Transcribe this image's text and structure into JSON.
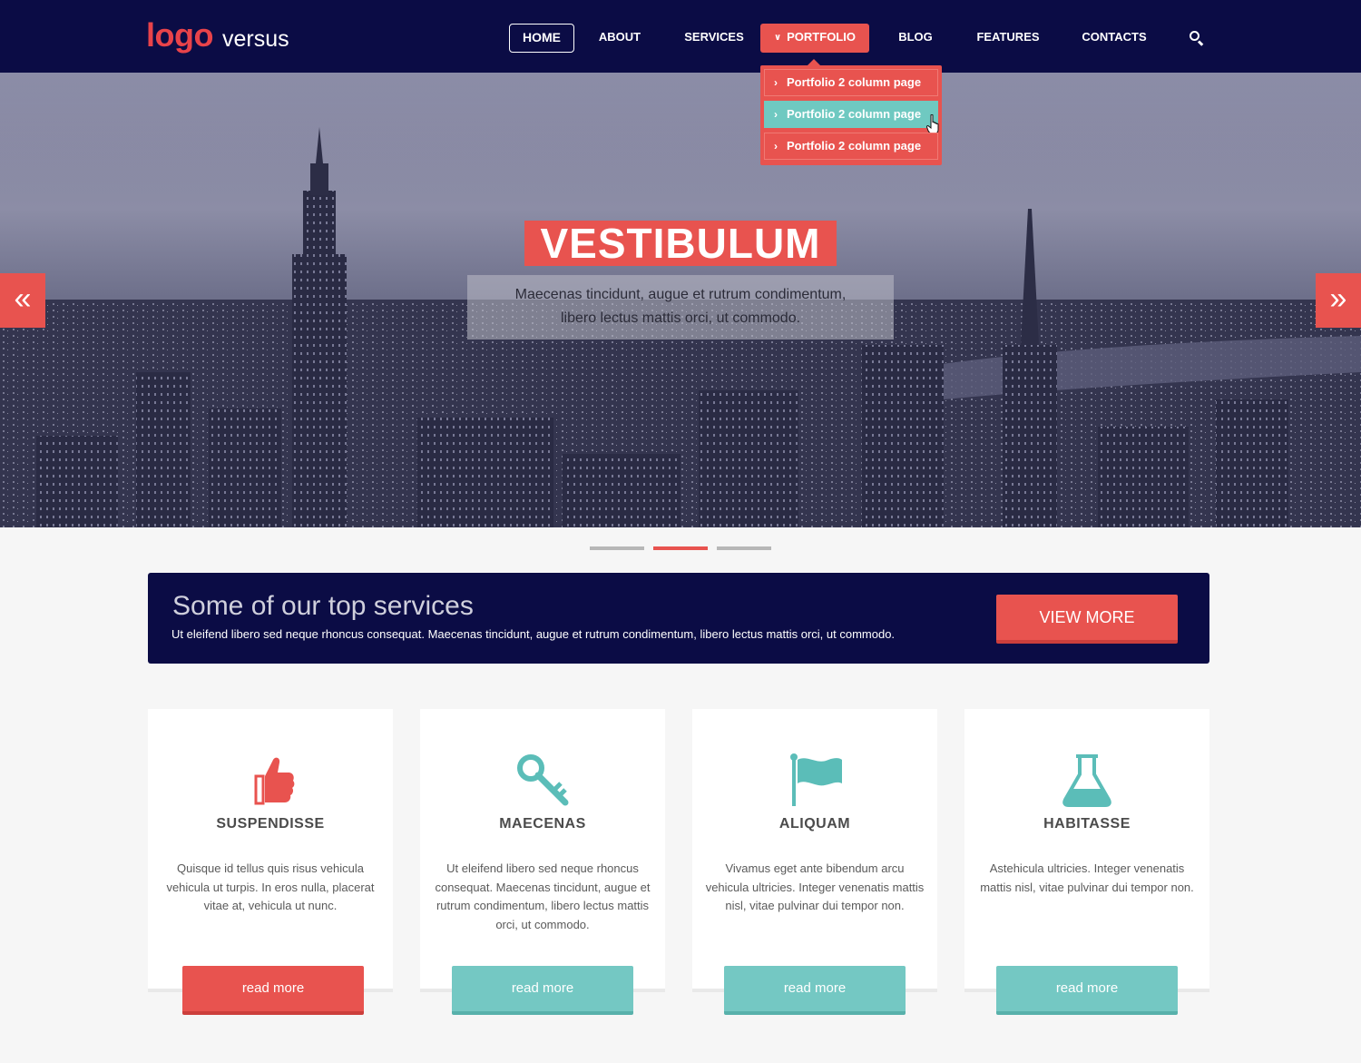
{
  "brand": {
    "logo_mark": "logo",
    "logo_text": "versus"
  },
  "nav": {
    "items": [
      {
        "label": "HOME"
      },
      {
        "label": "ABOUT"
      },
      {
        "label": "SERVICES"
      },
      {
        "label": "PORTFOLIO",
        "icon": "chevron-down-icon"
      },
      {
        "label": "BLOG"
      },
      {
        "label": "FEATURES"
      },
      {
        "label": "CONTACTS"
      }
    ],
    "search_icon": "search-icon",
    "dropdown": [
      {
        "label": "Portfolio 2 column page"
      },
      {
        "label": "Portfolio 2 column page"
      },
      {
        "label": "Portfolio 2 column page"
      }
    ]
  },
  "hero": {
    "title": "VESTIBULUM",
    "subtitle_line1": "Maecenas tincidunt, augue et rutrum condimentum,",
    "subtitle_line2": "libero lectus mattis orci, ut commodo.",
    "prev_icon": "double-chevron-left-icon",
    "next_icon": "double-chevron-right-icon",
    "slide_count": 3,
    "active_slide": 2
  },
  "banner": {
    "title": "Some of our top services",
    "text": "Ut eleifend libero sed neque rhoncus consequat. Maecenas tincidunt, augue et rutrum condimentum, libero lectus mattis orci, ut commodo.",
    "button": "VIEW MORE"
  },
  "cards": [
    {
      "icon": "thumbs-up-icon",
      "title": "SUSPENDISSE",
      "desc": "Quisque id tellus quis risus vehicula vehicula ut turpis. In eros nulla, placerat vitae at, vehicula ut nunc.",
      "button": "read more"
    },
    {
      "icon": "key-icon",
      "title": "MAECENAS",
      "desc": "Ut eleifend libero sed neque rhoncus consequat. Maecenas tincidunt, augue et rutrum condimentum, libero lectus mattis orci, ut commodo.",
      "button": "read more"
    },
    {
      "icon": "flag-icon",
      "title": "ALIQUAM",
      "desc": "Vivamus eget ante bibendum arcu vehicula ultricies. Integer venenatis mattis nisl, vitae pulvinar dui tempor non.",
      "button": "read more"
    },
    {
      "icon": "flask-icon",
      "title": "HABITASSE",
      "desc": "Astehicula ultricies. Integer venenatis mattis nisl, vitae pulvinar dui tempor non.",
      "button": "read more"
    }
  ],
  "colors": {
    "navy": "#0b0c45",
    "coral": "#e8534f",
    "teal": "#74c8c3"
  }
}
